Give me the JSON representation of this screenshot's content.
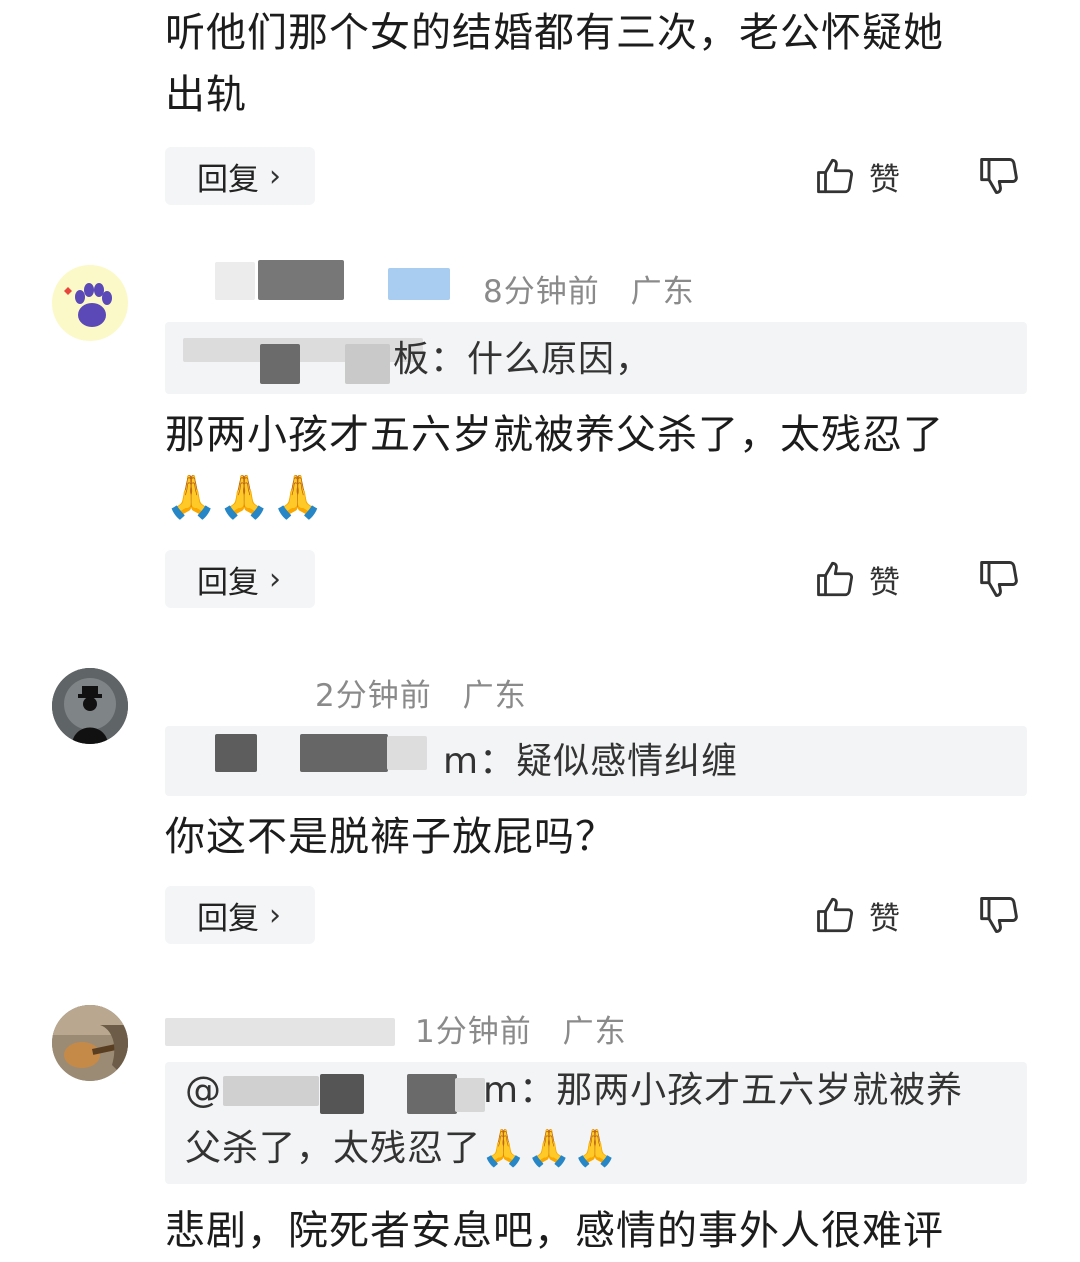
{
  "comments": [
    {
      "body_lines": [
        "听他们那个女的结婚都有三次，老公怀疑她",
        "出轨"
      ]
    },
    {
      "time": "8分钟前",
      "location": "广东",
      "quote_visible": "板：什么原因，",
      "body_line1": "那两小孩才五六岁就被养父杀了，太残忍了",
      "body_emoji": "🙏🙏🙏"
    },
    {
      "time": "2分钟前",
      "location": "广东",
      "quote_visible": "m：疑似感情纠缠",
      "body": "你这不是脱裤子放屁吗？"
    },
    {
      "time": "1分钟前",
      "location": "广东",
      "quote_prefix": "@",
      "quote_line1": "m：那两小孩才五六岁就被养",
      "quote_line2": "父杀了，太残忍了",
      "quote_emoji": "🙏🙏🙏",
      "body_partial": "悲剧，院死者安息吧，感情的事外人很难评"
    }
  ],
  "actions": {
    "reply_label": "回复",
    "reply_chevron": "›",
    "like_label": "赞",
    "like_icon": "thumbs-up-icon",
    "dislike_icon": "thumbs-down-icon"
  },
  "colors": {
    "reply_bg": "#f3f5f7",
    "quote_bg": "#f3f4f6",
    "meta_text": "#8a8a8a"
  }
}
